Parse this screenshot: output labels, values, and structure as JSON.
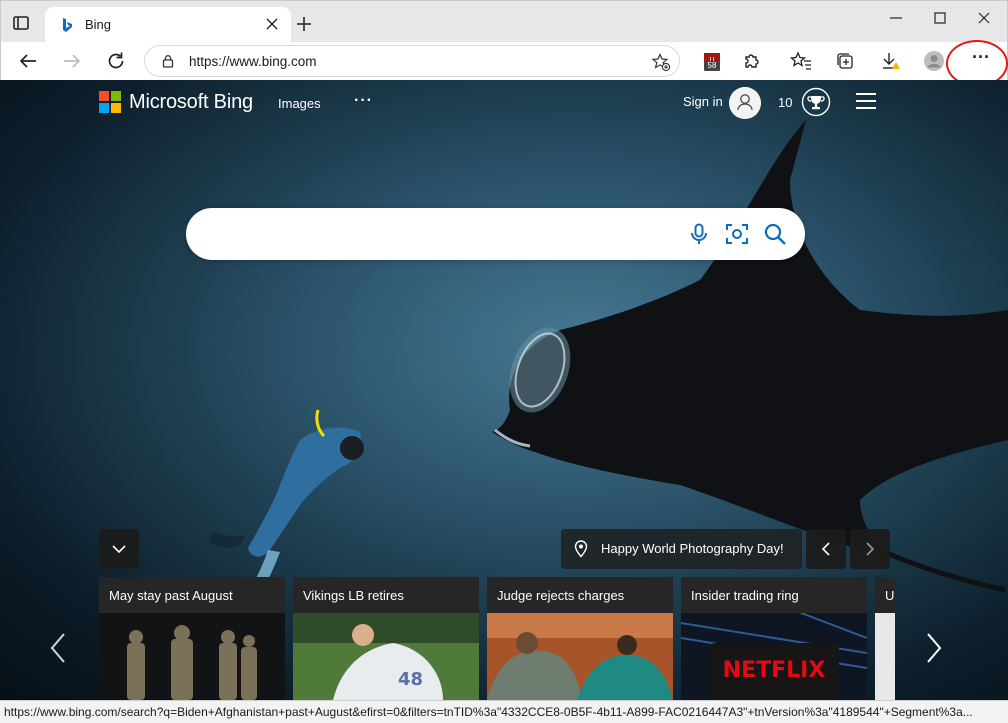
{
  "browser": {
    "tab_title": "Bing",
    "url": "https://www.bing.com",
    "extension_badge": "58",
    "menu_label": "···",
    "status_url": "https://www.bing.com/search?q=Biden+Afghanistan+past+August&efirst=0&filters=tnTID%3a\"4332CCE8-0B5F-4b11-A899-FAC0216447A3\"+tnVersion%3a\"4189544\"+Segment%3a..."
  },
  "bing": {
    "brand": "Microsoft Bing",
    "nav": {
      "images": "Images",
      "more": "···"
    },
    "signin": "Sign in",
    "rewards_count": "10",
    "search_placeholder": "",
    "location_text": "Happy World Photography Day!"
  },
  "news_cards": [
    {
      "headline": "May stay past August"
    },
    {
      "headline": "Vikings LB retires"
    },
    {
      "headline": "Judge rejects charges"
    },
    {
      "headline": "Insider trading ring"
    },
    {
      "headline": "U"
    }
  ],
  "card_image_texts": {
    "netflix": "NETFLIX",
    "jersey": "48"
  },
  "colors": {
    "ms_red": "#f25022",
    "ms_green": "#7fba00",
    "ms_blue": "#00a4ef",
    "ms_yellow": "#ffb900",
    "annotation": "#e01818",
    "bing_blue": "#0f6cbd"
  },
  "icons": [
    "tab-actions-icon",
    "bing-favicon",
    "close-icon",
    "plus-icon",
    "minimize-icon",
    "maximize-icon",
    "back-arrow-icon",
    "forward-arrow-icon",
    "refresh-icon",
    "lock-icon",
    "favorite-add-icon",
    "extension-icon",
    "puzzle-icon",
    "favorites-icon",
    "collections-icon",
    "download-icon",
    "profile-icon",
    "microphone-icon",
    "visual-search-icon",
    "search-icon",
    "chevron-down-icon",
    "location-pin-icon",
    "chevron-left-icon",
    "chevron-right-icon",
    "trophy-icon",
    "menu-icon"
  ]
}
